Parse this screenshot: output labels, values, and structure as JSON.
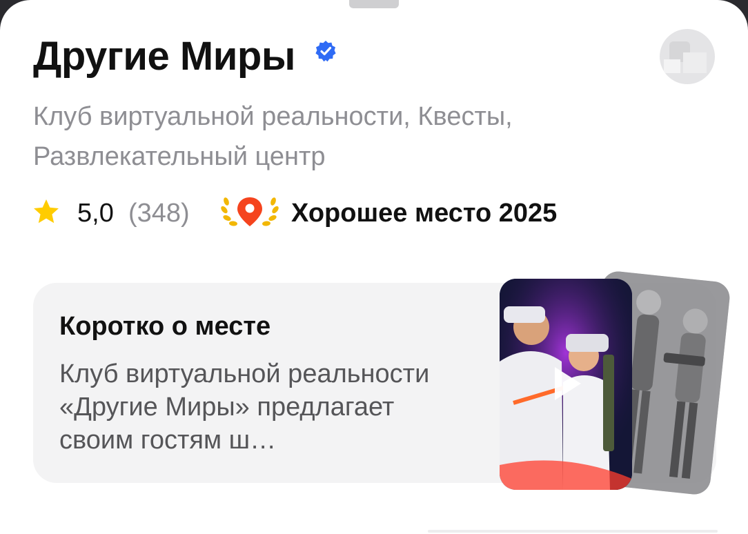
{
  "place": {
    "title": "Другие Миры",
    "verified_icon": "verified-badge-icon",
    "categories": "Клуб виртуальной реальности, Квесты, Развлекательный центр"
  },
  "rating": {
    "value": "5,0",
    "count": "(348)",
    "star_icon": "star-icon",
    "star_color": "#ffcc00"
  },
  "award": {
    "icon": "laurel-pin-icon",
    "text": "Хорошее место 2025",
    "pin_color": "#f5441e",
    "laurel_color": "#f2b705"
  },
  "about": {
    "title": "Коротко о месте",
    "text": "Клуб виртуальной реальности «Другие Миры» предлагает своим гостям ш…"
  },
  "media": {
    "play_icon": "play-icon"
  },
  "colors": {
    "verified": "#2f6bf5",
    "card_bg": "#f3f3f4",
    "secondary_text": "#8e8e93"
  }
}
